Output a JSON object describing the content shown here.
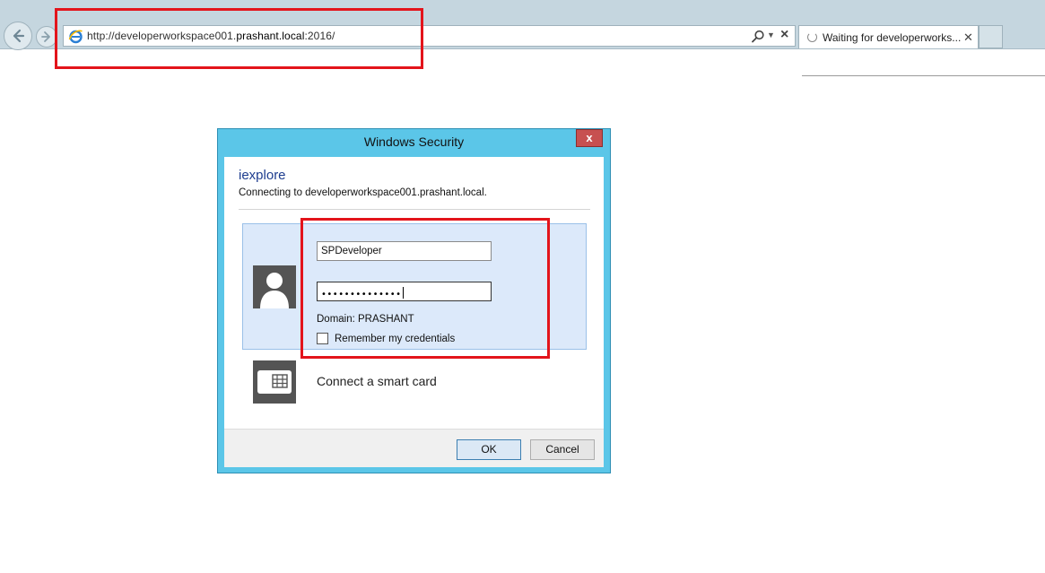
{
  "browser": {
    "url_prefix": "http://developerworkspace001.",
    "url_host": "prashant.local",
    "url_suffix": ":2016/",
    "tab_title": "Waiting for developerworks...",
    "icons": {
      "back": "back-arrow-icon",
      "forward": "forward-arrow-icon",
      "site": "ie-logo-icon",
      "search": "search-icon",
      "dropdown": "chevron-down-icon",
      "stop": "close-icon",
      "loading": "loading-spinner-icon"
    }
  },
  "dialog": {
    "title": "Windows Security",
    "close_label": "x",
    "app_name": "iexplore",
    "connecting_text": "Connecting to developerworkspace001.prashant.local.",
    "username_value": "SPDeveloper",
    "password_masked": "••••••••••••••",
    "domain_text": "Domain: PRASHANT",
    "remember_label": "Remember my credentials",
    "remember_checked": false,
    "smartcard_label": "Connect a smart card",
    "ok_label": "OK",
    "cancel_label": "Cancel"
  },
  "colors": {
    "dialog_frame": "#5bc6e8",
    "annotation_red": "#e3141b",
    "close_button": "#c75050",
    "credential_tile": "#dce9fa"
  }
}
